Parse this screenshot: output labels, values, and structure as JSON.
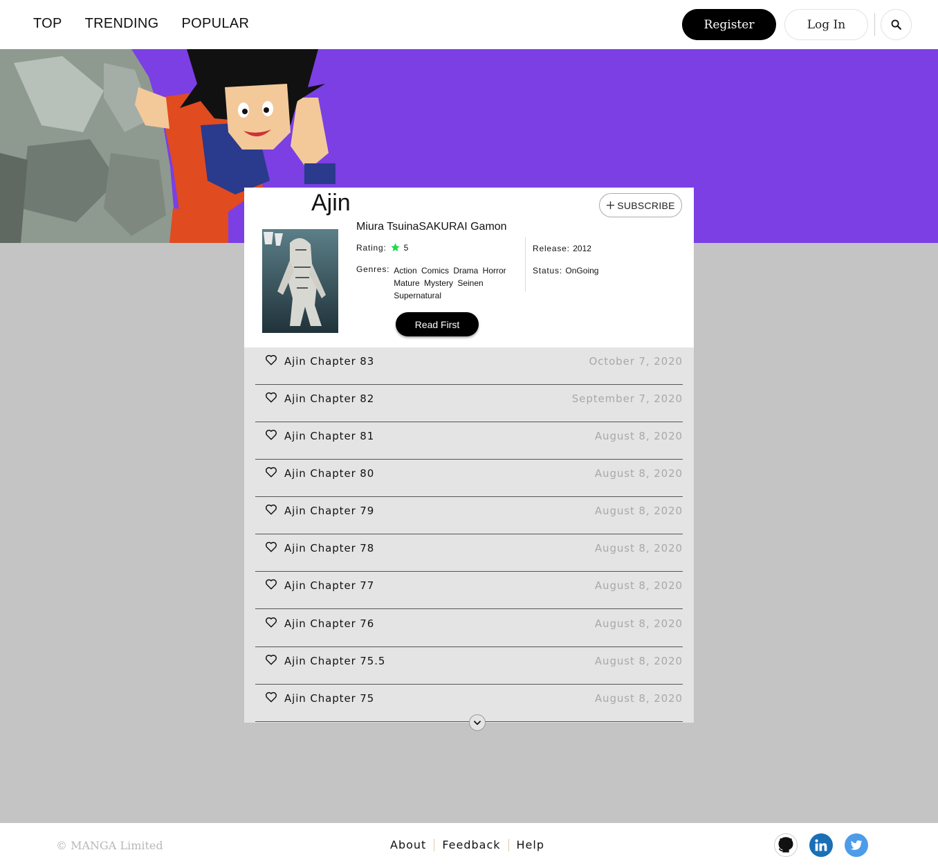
{
  "nav": {
    "links": [
      "TOP",
      "TRENDING",
      "POPULAR"
    ],
    "register_label": "Register",
    "login_label": "Log In",
    "search_icon": "search-icon"
  },
  "hero": {
    "background_color": "#7b3fe4",
    "image": "anime-character-climbing-rock"
  },
  "manga": {
    "title": "Ajin",
    "subscribe_label": "SUBSCRIBE",
    "author": "Miura TsuinaSAKURAI Gamon",
    "rating_label": "Rating:",
    "rating_value": "5",
    "genres_label": "Genres:",
    "genres": "Action Comics Drama Horror Mature Mystery Seinen Supernatural",
    "release_label": "Release:",
    "release_value": "2012",
    "status_label": "Status:",
    "status_value": "OnGoing",
    "read_first_label": "Read First",
    "accent_star_color": "#1ddb4c"
  },
  "chapters": [
    {
      "name": "Ajin Chapter 83",
      "date": "October 7, 2020"
    },
    {
      "name": "Ajin Chapter 82",
      "date": "September 7, 2020"
    },
    {
      "name": "Ajin Chapter 81",
      "date": "August 8, 2020"
    },
    {
      "name": "Ajin Chapter 80",
      "date": "August 8, 2020"
    },
    {
      "name": "Ajin Chapter 79",
      "date": "August 8, 2020"
    },
    {
      "name": "Ajin Chapter 78",
      "date": "August 8, 2020"
    },
    {
      "name": "Ajin Chapter 77",
      "date": "August 8, 2020"
    },
    {
      "name": "Ajin Chapter 76",
      "date": "August 8, 2020"
    },
    {
      "name": "Ajin Chapter 75.5",
      "date": "August 8, 2020"
    },
    {
      "name": "Ajin Chapter 75",
      "date": "August 8, 2020"
    }
  ],
  "footer": {
    "copyright": "© MANGA Limited",
    "links": [
      "About",
      "Feedback",
      "Help"
    ],
    "social": [
      "github-icon",
      "linkedin-icon",
      "twitter-icon"
    ]
  }
}
